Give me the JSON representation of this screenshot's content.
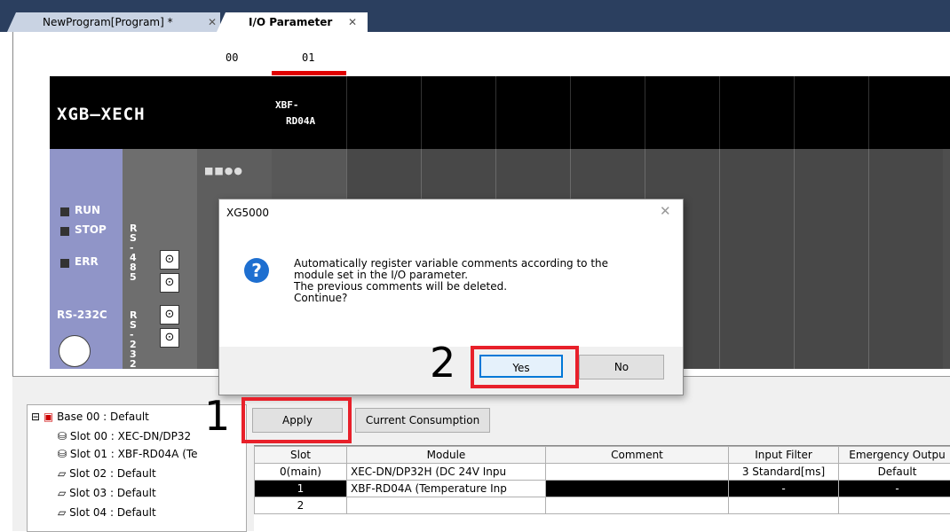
{
  "tabs": [
    {
      "label": "NewProgram[Program] *",
      "close": "✕"
    },
    {
      "label": "I/O Parameter",
      "close": "✕"
    }
  ],
  "rack": {
    "slot_numbers": [
      "00",
      "01"
    ],
    "cpu_logo": "XGB—XECH",
    "module_label_line1": "XBF-",
    "module_label_line2": "RD04A",
    "leds": [
      "RUN",
      "STOP",
      "ERR"
    ],
    "port_labels": [
      "RS-232C"
    ],
    "rs485": "RS-485",
    "rs232_vert": "RS-232"
  },
  "dialog": {
    "title": "XG5000",
    "close": "✕",
    "icon": "question-icon",
    "message": "Automatically register variable comments according to the\nmodule set in the I/O parameter.\nThe previous comments will be deleted.\nContinue?",
    "yes_label": "Yes",
    "no_label": "No"
  },
  "callouts": {
    "first": "1",
    "second": "2"
  },
  "toolbar": {
    "apply_label": "Apply",
    "consumption_label": "Current Consumption"
  },
  "tree": {
    "root": "Base 00 : Default",
    "items": [
      "Slot 00 : XEC-DN/DP32",
      "Slot 01 : XBF-RD04A (Te",
      "Slot 02 : Default",
      "Slot 03 : Default",
      "Slot 04 : Default"
    ]
  },
  "grid": {
    "headers": [
      "Slot",
      "Module",
      "Comment",
      "Input Filter",
      "Emergency Outpu"
    ],
    "rows": [
      [
        "0(main)",
        "XEC-DN/DP32H (DC 24V Inpu",
        "",
        "3 Standard[ms]",
        "Default"
      ],
      [
        "1",
        "XBF-RD04A (Temperature Inp",
        "",
        "-",
        "-"
      ],
      [
        "2",
        "",
        "",
        "",
        ""
      ]
    ]
  },
  "colors": {
    "accent_red": "#e8202a",
    "selection_blue": "#0078d7",
    "tabbar": "#2b3f5f"
  }
}
